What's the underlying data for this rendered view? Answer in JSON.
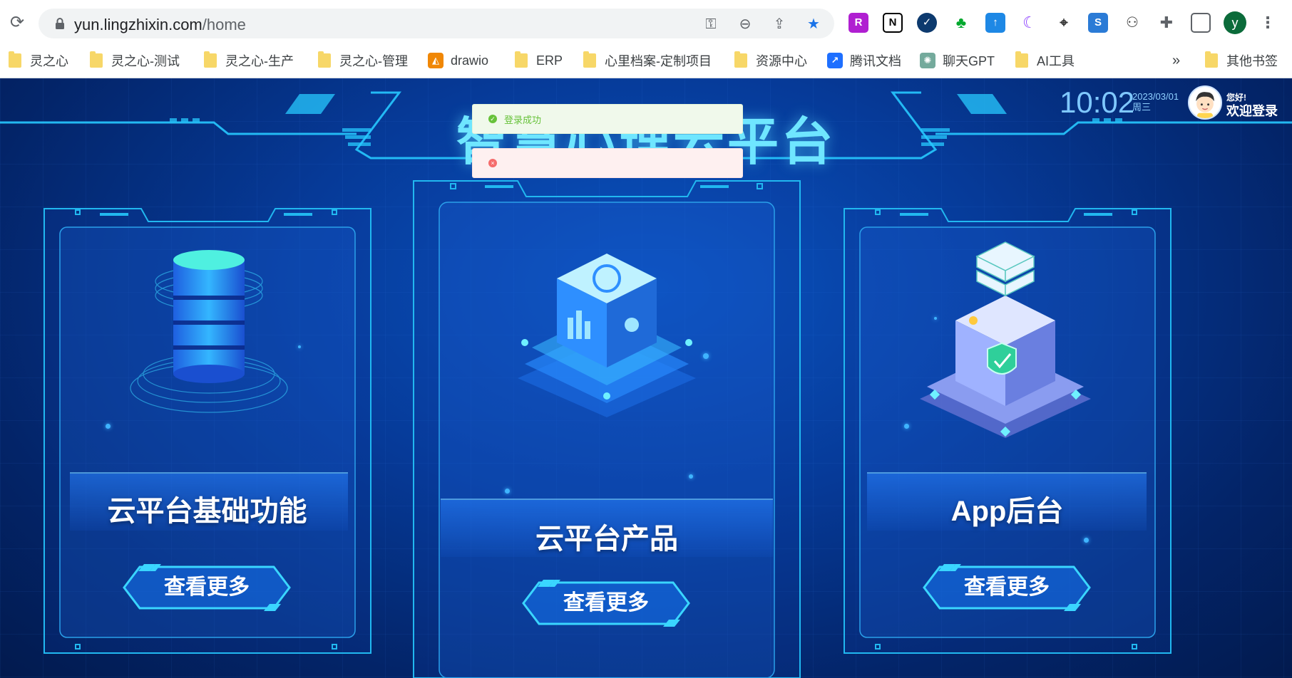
{
  "browser": {
    "url_host": "yun.lingzhixin.com",
    "url_path": "/home",
    "profile_initial": "y",
    "bookmarks": [
      {
        "label": "灵之心",
        "icon": "folder-icon"
      },
      {
        "label": "灵之心-测试",
        "icon": "folder-icon"
      },
      {
        "label": "灵之心-生产",
        "icon": "folder-icon"
      },
      {
        "label": "灵之心-管理",
        "icon": "folder-icon"
      },
      {
        "label": "drawio",
        "icon": "drawio-icon"
      },
      {
        "label": "ERP",
        "icon": "folder-icon"
      },
      {
        "label": "心里档案-定制项目",
        "icon": "folder-icon"
      },
      {
        "label": "资源中心",
        "icon": "folder-icon"
      },
      {
        "label": "腾讯文档",
        "icon": "tencent-docs-icon"
      },
      {
        "label": "聊天GPT",
        "icon": "chatgpt-icon"
      },
      {
        "label": "AI工具",
        "icon": "folder-icon"
      }
    ],
    "bookmarks_overflow": "»",
    "other_bookmarks": "其他书签"
  },
  "header": {
    "title": "智慧心理云平台",
    "time": "10:02",
    "date": "2023/03/01",
    "weekday": "周三",
    "greeting_small": "您好!",
    "greeting_big": "欢迎登录"
  },
  "toasts": {
    "success": "登录成功",
    "error": ""
  },
  "cards": [
    {
      "title": "云平台基础功能",
      "button": "查看更多"
    },
    {
      "title": "云平台产品",
      "button": "查看更多"
    },
    {
      "title": "App后台",
      "button": "查看更多"
    }
  ],
  "colors": {
    "accent": "#6fe6ff",
    "background": "#063a98",
    "success": "#67c23a",
    "error": "#f56c6c"
  }
}
